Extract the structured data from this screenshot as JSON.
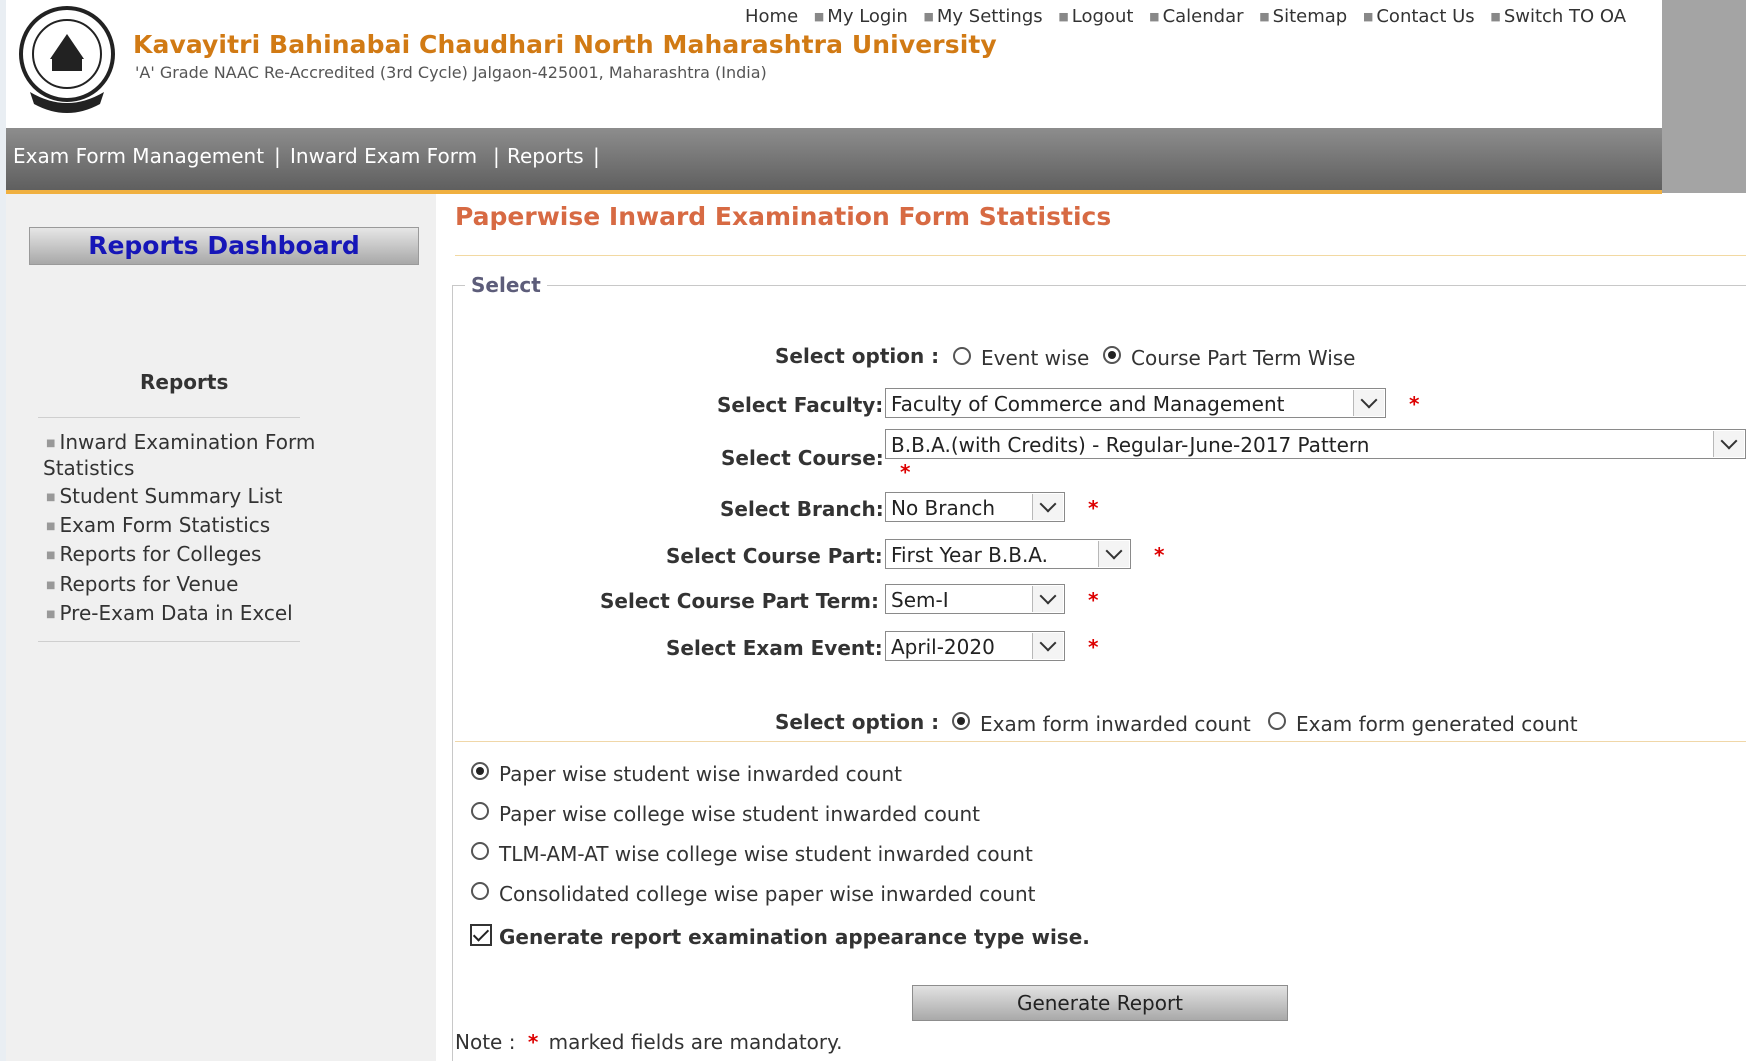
{
  "header": {
    "university_name": "Kavayitri Bahinabai Chaudhari North Maharashtra University",
    "subtitle": "'A' Grade NAAC Re-Accredited (3rd Cycle) Jalgaon-425001, Maharashtra (India)",
    "top_links": [
      "Home",
      "My Login",
      "My Settings",
      "Logout",
      "Calendar",
      "Sitemap",
      "Contact Us",
      "Switch TO OA"
    ],
    "brand_color": "#d17a14"
  },
  "navbar": {
    "items": [
      "Exam Form Management",
      "Inward Exam Form",
      "Reports"
    ],
    "separator": "|"
  },
  "sidebar": {
    "dashboard_title": "Reports Dashboard",
    "section_title": "Reports",
    "items": [
      "Inward Examination Form",
      "Statistics",
      "Student Summary List",
      "Exam Form Statistics",
      "Reports for Colleges",
      "Reports for Venue",
      "Pre-Exam Data in Excel"
    ]
  },
  "main": {
    "page_title": "Paperwise Inward Examination Form Statistics",
    "legend": "Select",
    "select_option_label": "Select option :",
    "option_group_1": [
      {
        "label": "Event wise",
        "selected": false
      },
      {
        "label": "Course Part Term Wise",
        "selected": true
      }
    ],
    "fields": {
      "faculty": {
        "label": "Select Faculty:",
        "value": "Faculty of Commerce and Management"
      },
      "course": {
        "label": "Select Course:",
        "value": "B.B.A.(with Credits) - Regular-June-2017 Pattern"
      },
      "branch": {
        "label": "Select Branch:",
        "value": "No Branch"
      },
      "course_part": {
        "label": "Select Course Part:",
        "value": "First Year B.B.A."
      },
      "course_part_term": {
        "label": "Select Course Part Term:",
        "value": "Sem-I"
      },
      "exam_event": {
        "label": "Select Exam Event:",
        "value": "April-2020"
      }
    },
    "required_mark": "*",
    "option_group_2": [
      {
        "label": "Exam form inwarded count",
        "selected": true
      },
      {
        "label": "Exam form generated count",
        "selected": false
      }
    ],
    "report_types": [
      {
        "label": "Paper wise student wise inwarded count",
        "selected": true
      },
      {
        "label": "Paper wise college wise student inwarded count",
        "selected": false
      },
      {
        "label": "TLM-AM-AT wise college wise student inwarded count",
        "selected": false
      },
      {
        "label": "Consolidated college wise paper wise inwarded count",
        "selected": false
      }
    ],
    "checkbox_label": "Generate report examination appearance type wise.",
    "checkbox_checked": true,
    "generate_button": "Generate Report",
    "note_prefix": "Note :",
    "note_text": "marked fields are mandatory."
  }
}
